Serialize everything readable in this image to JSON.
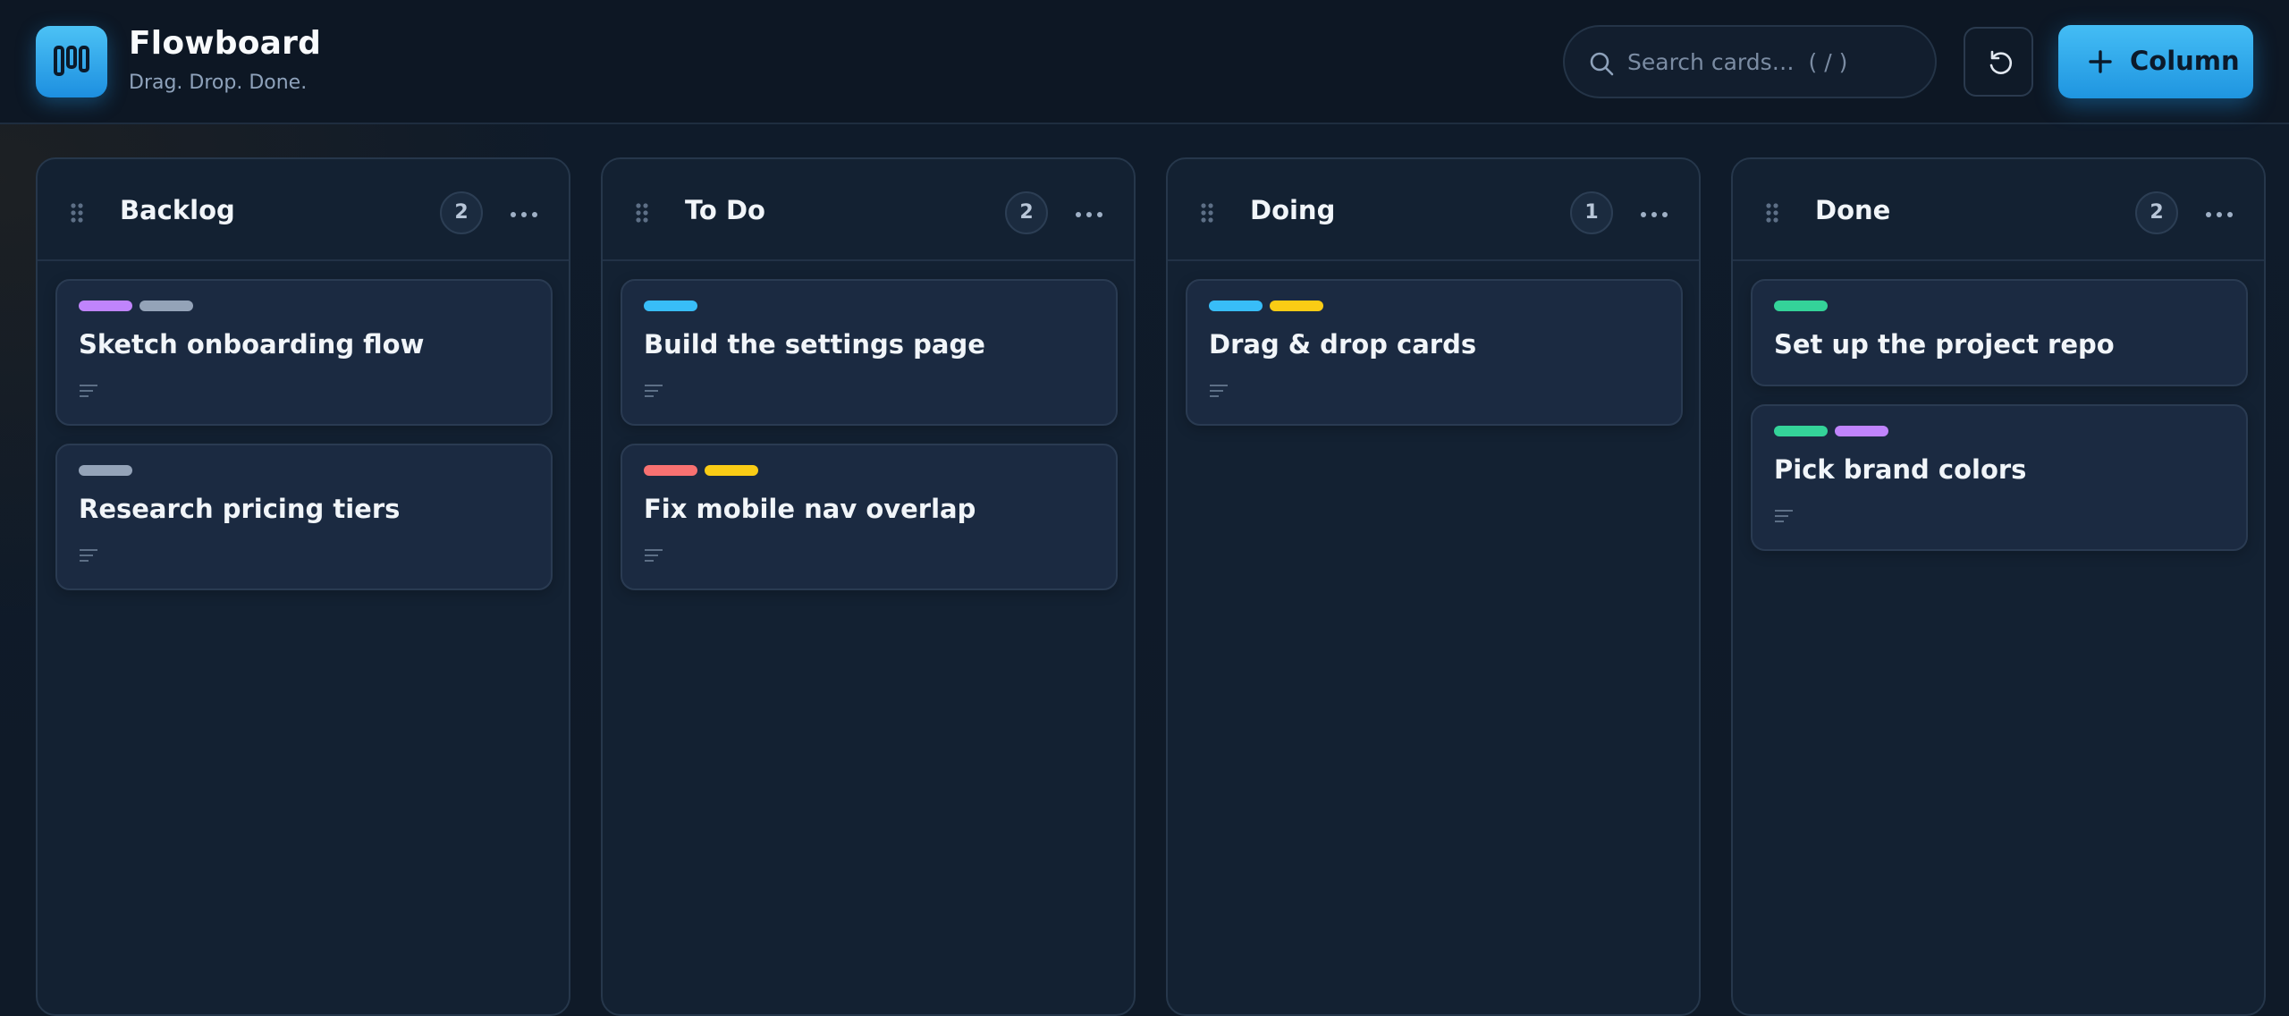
{
  "app": {
    "title": "Flowboard",
    "subtitle": "Drag. Drop. Done."
  },
  "search": {
    "placeholder": "Search cards…  ( / )"
  },
  "toolbar": {
    "add_column_label": "Column"
  },
  "colors": {
    "accent": "#2aa8ec",
    "purple": "#c084fc",
    "gray": "#94a3b8",
    "cyan": "#38bdf8",
    "red": "#f87171",
    "yellow": "#facc15",
    "green": "#34d399"
  },
  "columns": [
    {
      "title": "Backlog",
      "count": "2",
      "cards": [
        {
          "title": "Sketch onboarding flow",
          "tags": [
            "purple",
            "gray"
          ]
        },
        {
          "title": "Research pricing tiers",
          "tags": [
            "gray"
          ]
        }
      ]
    },
    {
      "title": "To Do",
      "count": "2",
      "cards": [
        {
          "title": "Build the settings page",
          "tags": [
            "cyan"
          ]
        },
        {
          "title": "Fix mobile nav overlap",
          "tags": [
            "red",
            "yellow"
          ]
        }
      ]
    },
    {
      "title": "Doing",
      "count": "1",
      "cards": [
        {
          "title": "Drag & drop cards",
          "tags": [
            "cyan",
            "yellow"
          ]
        }
      ]
    },
    {
      "title": "Done",
      "count": "2",
      "cards": [
        {
          "title": "Set up the project repo",
          "tags": [
            "green"
          ]
        },
        {
          "title": "Pick brand colors",
          "tags": [
            "green",
            "purple"
          ]
        }
      ]
    }
  ]
}
